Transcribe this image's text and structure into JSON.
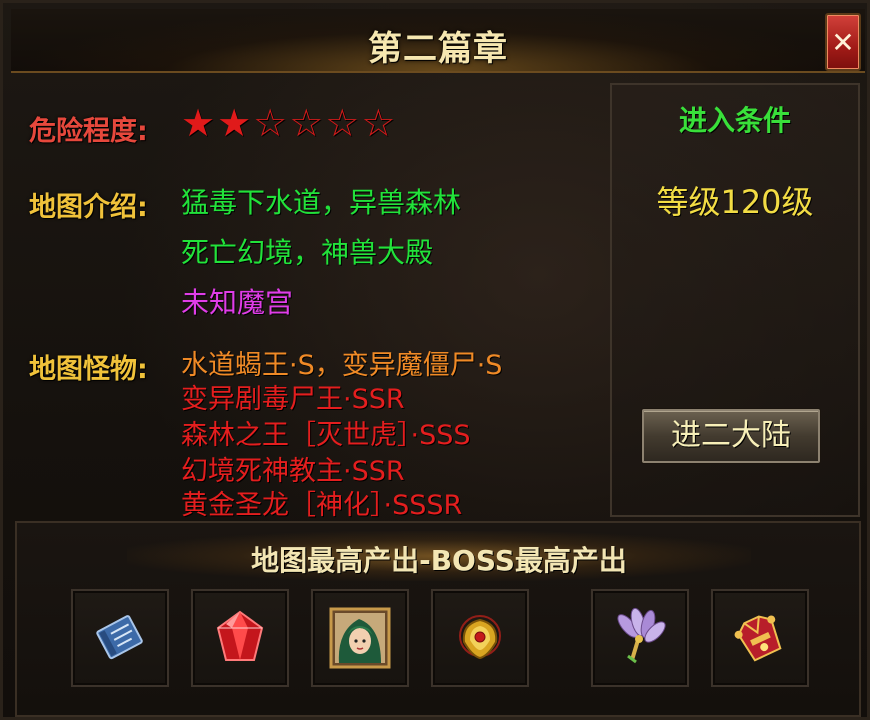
{
  "window": {
    "title": "第二篇章",
    "close_glyph": "✕"
  },
  "danger": {
    "label": "危险程度:",
    "filled_stars": 2,
    "total_stars": 6,
    "filled_glyph": "★★",
    "empty_glyph": "☆☆☆☆"
  },
  "intro": {
    "label": "地图介绍:",
    "lines": [
      {
        "text": "猛毒下水道，异兽森林",
        "color": "#22e23a"
      },
      {
        "text": "死亡幻境，神兽大殿",
        "color": "#22e23a"
      },
      {
        "text": "未知魔宫",
        "color": "#e03de8"
      }
    ]
  },
  "monsters": {
    "label": "地图怪物:",
    "lines": [
      {
        "text": "水道蝎王·S，变异魔僵尸·S",
        "color": "#f08a26"
      },
      {
        "text": "变异剧毒尸王·SSR",
        "color": "#e41e1e"
      },
      {
        "text": "森林之王［灭世虎］·SSS",
        "color": "#e41e1e"
      },
      {
        "text": "幻境死神教主·SSR",
        "color": "#e41e1e"
      },
      {
        "text": "黄金圣龙［神化］·SSSR",
        "color": "#e41e1e"
      }
    ]
  },
  "condition": {
    "title": "进入条件",
    "value": "等级120级",
    "button_label": "进二大陆"
  },
  "rewards": {
    "title": "地图最高产出-BOSS最高产出",
    "items": [
      {
        "icon": "skill-book-icon"
      },
      {
        "icon": "red-gem-icon"
      },
      {
        "icon": "hero-portrait-icon"
      },
      {
        "icon": "gold-amulet-icon"
      },
      {
        "icon": "feather-fan-icon"
      },
      {
        "icon": "ornate-armor-icon"
      }
    ]
  },
  "colors": {
    "danger_label": "#e6483c",
    "section_label": "#f0c23a",
    "condition_title": "#39e03a",
    "condition_value": "#f2dc44",
    "close_button": "#c0302a"
  }
}
